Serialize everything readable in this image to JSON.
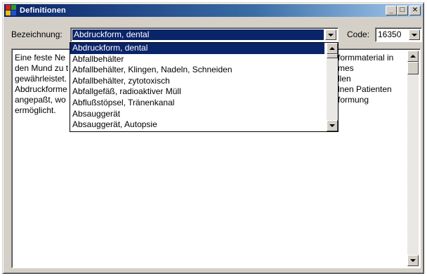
{
  "window": {
    "title": "Definitionen",
    "buttons": {
      "minimize": "_",
      "maximize": "□",
      "close": "✕"
    }
  },
  "bezeichnung": {
    "label": "Bezeichnung:",
    "value": "Abdruckform, dental"
  },
  "code": {
    "label": "Code:",
    "value": "16350"
  },
  "dropdown": {
    "items": [
      "Abdruckform, dental",
      "Abfallbehälter",
      "Abfallbehälter, Klingen, Nadeln, Schneiden",
      "Abfallbehälter, zytotoxisch",
      "Abfallgefäß, radioaktiver Müll",
      "Abflußstöpsel, Tränenkanal",
      "Absauggerät",
      "Absauggerät, Autopsie"
    ],
    "selected_index": 0
  },
  "description": {
    "lines": [
      {
        "left": "Eine feste Ne",
        "right": "formmaterial in"
      },
      {
        "left": "den Mund zu t",
        "right": "mes"
      },
      {
        "left": "gewährleistet.",
        "right": "llen"
      },
      {
        "left": "Abdruckforme",
        "right": "lnen Patienten"
      },
      {
        "left": "angepaßt, wo",
        "right": "formung"
      },
      {
        "left": "ermöglicht.",
        "right": ""
      }
    ]
  }
}
